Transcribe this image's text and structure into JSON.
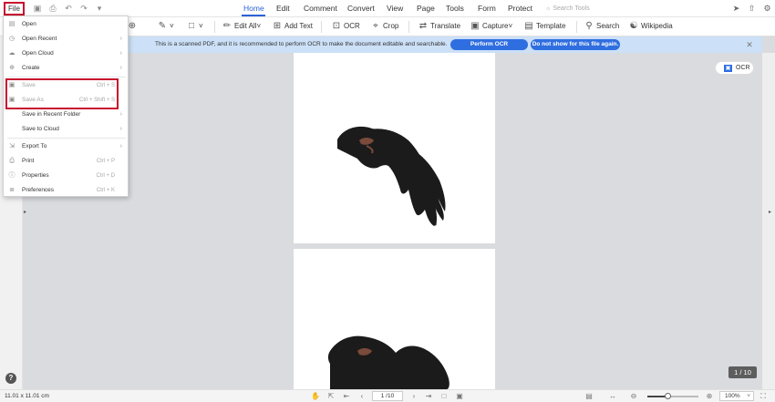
{
  "menubar": {
    "file_label": "File",
    "tabs": [
      {
        "label": "Home",
        "active": true
      },
      {
        "label": "Edit",
        "active": false
      },
      {
        "label": "Comment",
        "active": false
      },
      {
        "label": "Convert",
        "active": false
      },
      {
        "label": "View",
        "active": false
      },
      {
        "label": "Page",
        "active": false
      },
      {
        "label": "Tools",
        "active": false
      },
      {
        "label": "Form",
        "active": false
      },
      {
        "label": "Protect",
        "active": false
      }
    ],
    "search_placeholder": "Search Tools"
  },
  "toolbar": {
    "edit_all": "Edit All",
    "add_text": "Add Text",
    "ocr": "OCR",
    "crop": "Crop",
    "translate": "Translate",
    "capture": "Capture",
    "template": "Template",
    "search": "Search",
    "wikipedia": "Wikipedia"
  },
  "banner": {
    "message": "This is a scanned PDF, and it is recommended to perform OCR to make the document editable and searchable.",
    "perform_ocr": "Perform OCR",
    "dont_show": "Do not show for this file again."
  },
  "file_menu": {
    "items": [
      {
        "label": "Open",
        "icon": "folder-icon",
        "shortcut": "",
        "arrow": false,
        "disabled": false
      },
      {
        "label": "Open Recent",
        "icon": "clock-icon",
        "shortcut": "",
        "arrow": true,
        "disabled": false
      },
      {
        "label": "Open Cloud",
        "icon": "cloud-icon",
        "shortcut": "",
        "arrow": true,
        "disabled": false
      },
      {
        "label": "Create",
        "icon": "plus-icon",
        "shortcut": "",
        "arrow": true,
        "disabled": false
      },
      {
        "label": "Save",
        "icon": "save-icon",
        "shortcut": "Ctrl + S",
        "arrow": false,
        "disabled": true
      },
      {
        "label": "Save As",
        "icon": "save-as-icon",
        "shortcut": "Ctrl + Shift + S",
        "arrow": false,
        "disabled": true
      },
      {
        "label": "Save in Recent Folder",
        "icon": "",
        "shortcut": "",
        "arrow": true,
        "disabled": false
      },
      {
        "label": "Save to Cloud",
        "icon": "",
        "shortcut": "",
        "arrow": true,
        "disabled": false
      },
      {
        "label": "Export To",
        "icon": "export-icon",
        "shortcut": "",
        "arrow": true,
        "disabled": false
      },
      {
        "label": "Print",
        "icon": "print-icon",
        "shortcut": "Ctrl + P",
        "arrow": false,
        "disabled": false
      },
      {
        "label": "Properties",
        "icon": "properties-icon",
        "shortcut": "Ctrl + D",
        "arrow": false,
        "disabled": false
      },
      {
        "label": "Preferences",
        "icon": "preferences-icon",
        "shortcut": "Ctrl + K",
        "arrow": false,
        "disabled": false
      }
    ]
  },
  "ocr_pill": {
    "label": "OCR"
  },
  "page_counter": "1 / 10",
  "statusbar": {
    "dimensions": "11.01 x 11.01 cm",
    "page_input": "1 /10",
    "zoom": "100%",
    "zoom_level": 0.4
  },
  "colors": {
    "accent": "#2b64d6",
    "highlight": "#c8102e",
    "banner_bg": "#cce0f7",
    "button_blue": "#2f6ee0"
  }
}
